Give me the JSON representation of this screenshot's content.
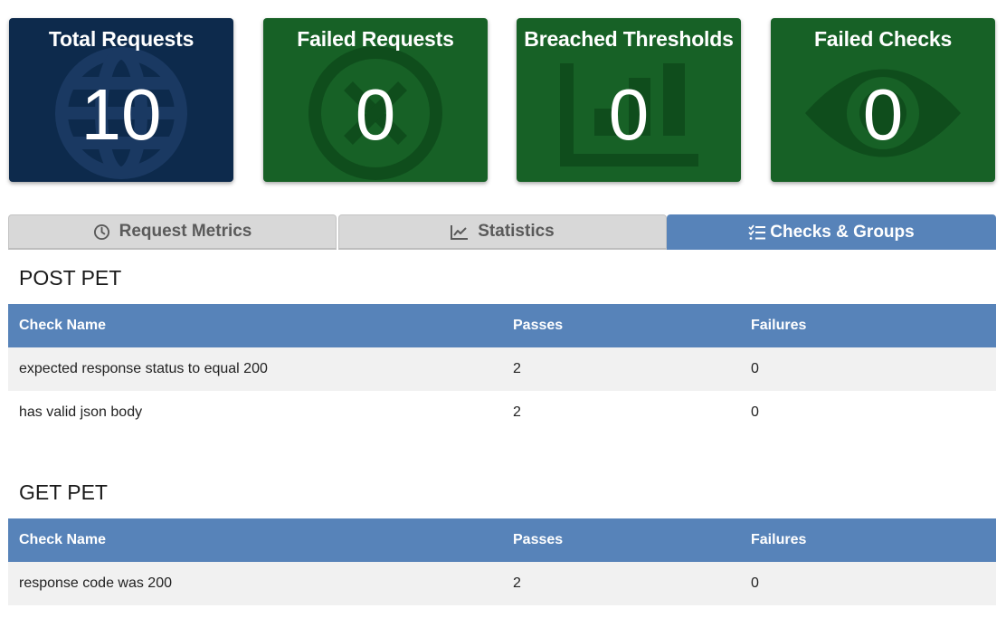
{
  "cards": [
    {
      "title": "Total Requests",
      "value": "10",
      "icon": "globe-icon",
      "color": "#0d2a4c"
    },
    {
      "title": "Failed Requests",
      "value": "0",
      "icon": "times-circle-icon",
      "color": "#176126"
    },
    {
      "title": "Breached Thresholds",
      "value": "0",
      "icon": "bar-chart-icon",
      "color": "#176126"
    },
    {
      "title": "Failed Checks",
      "value": "0",
      "icon": "eye-icon",
      "color": "#176126"
    }
  ],
  "tabs": [
    {
      "label": "Request Metrics",
      "icon": "clock-icon",
      "active": false
    },
    {
      "label": "Statistics",
      "icon": "line-chart-icon",
      "active": false
    },
    {
      "label": "Checks & Groups",
      "icon": "checklist-icon",
      "active": true
    }
  ],
  "colors": {
    "accent": "#5783b9",
    "success": "#176126",
    "primary": "#0d2a4c"
  },
  "groups": [
    {
      "title": "POST PET",
      "headers": [
        "Check Name",
        "Passes",
        "Failures"
      ],
      "rows": [
        [
          "expected response status to equal 200",
          "2",
          "0"
        ],
        [
          "has valid json body",
          "2",
          "0"
        ]
      ]
    },
    {
      "title": "GET PET",
      "headers": [
        "Check Name",
        "Passes",
        "Failures"
      ],
      "rows": [
        [
          "response code was 200",
          "2",
          "0"
        ]
      ]
    }
  ]
}
